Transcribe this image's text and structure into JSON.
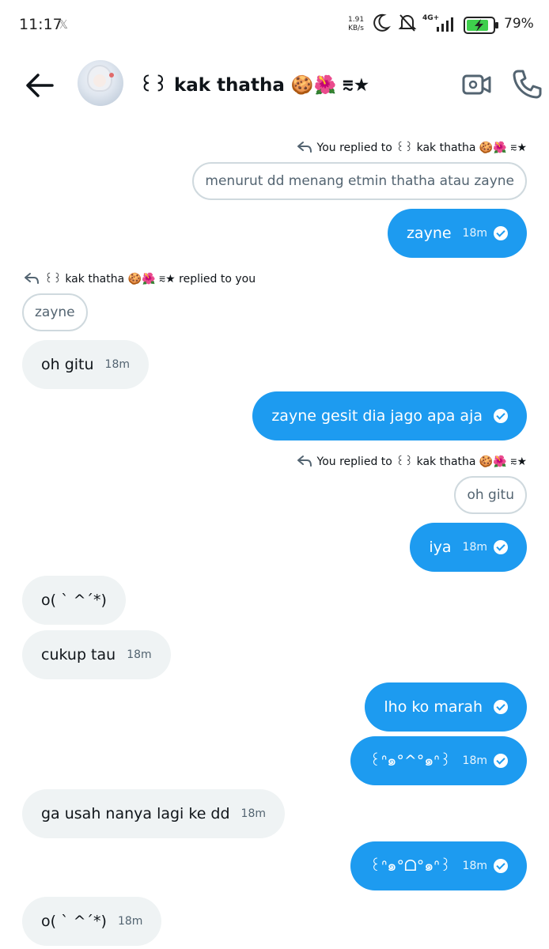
{
  "status_bar": {
    "time": "11:17",
    "notification_icon": "x-app-icon",
    "net_speed_value": "1.91",
    "net_speed_unit": "KB/s",
    "network": "4G+",
    "battery_percent": "79%"
  },
  "header": {
    "contact_name": "꒰꒱ kak thatha 🍪🌺 ⩳★",
    "back_icon": "arrow-left-icon",
    "video_icon": "video-call-icon",
    "call_icon": "phone-icon"
  },
  "messages": [
    {
      "kind": "reply_label",
      "side": "right",
      "text": "You replied to ꒰꒱ kak thatha 🍪🌺 ⩳★"
    },
    {
      "kind": "quote",
      "side": "right",
      "text": "menurut dd menang etmin thatha atau zayne"
    },
    {
      "kind": "bubble",
      "side": "sent",
      "text": "zayne",
      "time": "18m"
    },
    {
      "kind": "reply_label",
      "side": "left",
      "text": "꒰꒱ kak thatha 🍪🌺 ⩳★ replied to you"
    },
    {
      "kind": "quote",
      "side": "left",
      "text": "zayne"
    },
    {
      "kind": "bubble",
      "side": "recv",
      "text": "oh gitu",
      "time": "18m"
    },
    {
      "kind": "bubble",
      "side": "sent",
      "text": "zayne gesit dia jago apa aja",
      "time": ""
    },
    {
      "kind": "reply_label",
      "side": "right",
      "text": "You replied to ꒰꒱ kak thatha 🍪🌺 ⩳★"
    },
    {
      "kind": "quote",
      "side": "right",
      "text": "oh gitu"
    },
    {
      "kind": "bubble",
      "side": "sent",
      "text": "iya",
      "time": "18m"
    },
    {
      "kind": "bubble",
      "side": "recv",
      "text": "o( ˋ ^´*)",
      "time": ""
    },
    {
      "kind": "bubble",
      "side": "recv",
      "text": "cukup tau",
      "time": "18m"
    },
    {
      "kind": "bubble",
      "side": "sent",
      "text": "lho ko marah",
      "time": ""
    },
    {
      "kind": "bubble",
      "side": "sent",
      "text": "꒰ᐢ๑°^°๑ᐢ꒱",
      "time": "18m"
    },
    {
      "kind": "bubble",
      "side": "recv",
      "text": "ga usah nanya lagi ke dd",
      "time": "18m"
    },
    {
      "kind": "bubble",
      "side": "sent",
      "text": "꒰ᐢ๑°ᗝ°๑ᐢ꒱",
      "time": "18m"
    },
    {
      "kind": "bubble",
      "side": "recv",
      "text": "o( ˋ ^´*)",
      "time": "18m"
    }
  ]
}
